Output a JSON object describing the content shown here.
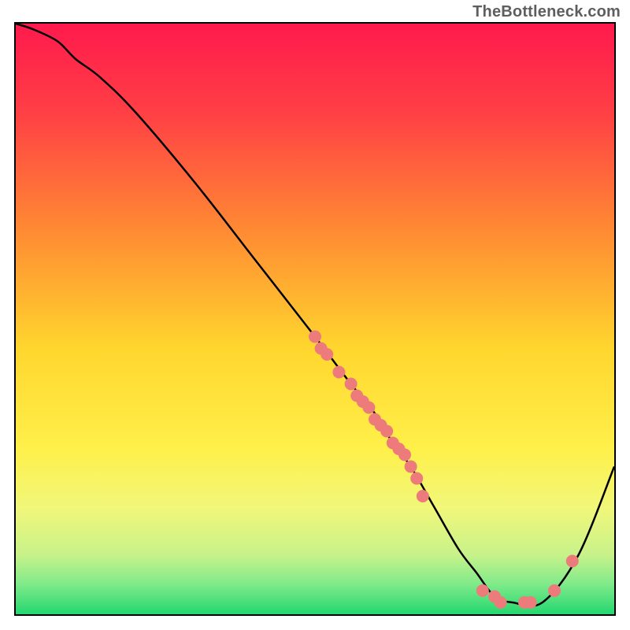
{
  "watermark": "TheBottleneck.com",
  "chart_data": {
    "type": "line",
    "title": "",
    "xlabel": "",
    "ylabel": "",
    "xlim": [
      0,
      100
    ],
    "ylim": [
      0,
      100
    ],
    "grid": false,
    "legend": false,
    "background": {
      "kind": "vertical-gradient",
      "stops": [
        {
          "offset": 0.0,
          "color": "#ff1a4d"
        },
        {
          "offset": 0.15,
          "color": "#ff3f45"
        },
        {
          "offset": 0.35,
          "color": "#ff8a33"
        },
        {
          "offset": 0.55,
          "color": "#ffd62e"
        },
        {
          "offset": 0.72,
          "color": "#fff04a"
        },
        {
          "offset": 0.82,
          "color": "#f1f77a"
        },
        {
          "offset": 0.9,
          "color": "#c7f28a"
        },
        {
          "offset": 0.95,
          "color": "#7eea8a"
        },
        {
          "offset": 1.0,
          "color": "#24d76f"
        }
      ]
    },
    "series": [
      {
        "name": "bottleneck-curve",
        "x": [
          0,
          3,
          7,
          10,
          14,
          20,
          30,
          40,
          50,
          56,
          60,
          63,
          66,
          70,
          74,
          77,
          80,
          83,
          88,
          94,
          100
        ],
        "y": [
          100,
          99,
          97,
          94,
          91,
          85,
          73,
          60,
          47,
          39,
          34,
          29,
          25,
          18,
          11,
          7,
          3,
          2,
          2,
          10,
          25
        ],
        "color": "#000000",
        "stroke_width": 2.5
      }
    ],
    "markers": {
      "color": "#ee7b7b",
      "radius": 8,
      "points": [
        {
          "x": 50,
          "y": 47
        },
        {
          "x": 51,
          "y": 45
        },
        {
          "x": 52,
          "y": 44
        },
        {
          "x": 54,
          "y": 41
        },
        {
          "x": 56,
          "y": 39
        },
        {
          "x": 57,
          "y": 37
        },
        {
          "x": 58,
          "y": 36
        },
        {
          "x": 59,
          "y": 35
        },
        {
          "x": 60,
          "y": 33
        },
        {
          "x": 61,
          "y": 32
        },
        {
          "x": 62,
          "y": 31
        },
        {
          "x": 63,
          "y": 29
        },
        {
          "x": 64,
          "y": 28
        },
        {
          "x": 65,
          "y": 27
        },
        {
          "x": 66,
          "y": 25
        },
        {
          "x": 67,
          "y": 23
        },
        {
          "x": 68,
          "y": 20
        },
        {
          "x": 78,
          "y": 4
        },
        {
          "x": 80,
          "y": 3
        },
        {
          "x": 81,
          "y": 2
        },
        {
          "x": 85,
          "y": 2
        },
        {
          "x": 86,
          "y": 2
        },
        {
          "x": 90,
          "y": 4
        },
        {
          "x": 93,
          "y": 9
        }
      ]
    }
  }
}
